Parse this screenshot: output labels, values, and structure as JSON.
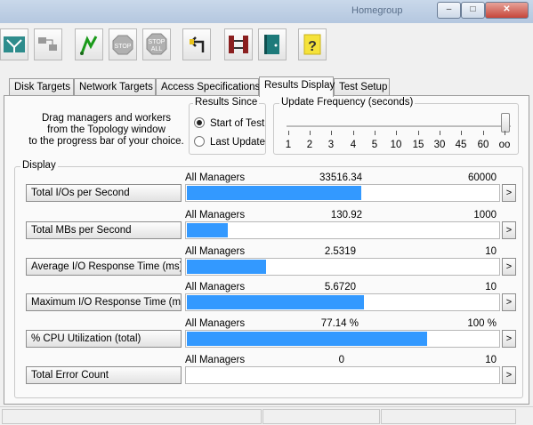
{
  "window": {
    "title_blurred": "Homegroup",
    "controls": [
      "–",
      "□",
      "✕"
    ]
  },
  "toolbar": {
    "buttons": [
      {
        "name": "topology-icon"
      },
      {
        "name": "disconnect-icon"
      },
      {
        "name": "start-flag-icon"
      },
      {
        "name": "stop-icon",
        "label": "STOP"
      },
      {
        "name": "stop-all-icon",
        "label": "STOP ALL"
      },
      {
        "name": "reset-icon"
      },
      {
        "name": "new-worker-icon"
      },
      {
        "name": "exit-icon"
      },
      {
        "name": "help-icon",
        "label": "?"
      }
    ]
  },
  "tabs": [
    "Disk Targets",
    "Network Targets",
    "Access Specifications",
    "Results Display",
    "Test Setup"
  ],
  "active_tab": "Results Display",
  "instructions": [
    "Drag managers and workers",
    "from the Topology window",
    "to the progress bar of your choice."
  ],
  "results_since": {
    "legend": "Results Since",
    "options": [
      "Start of Test",
      "Last Update"
    ],
    "selected": "Start of Test"
  },
  "update_frequency": {
    "legend": "Update Frequency (seconds)",
    "ticks": [
      "1",
      "2",
      "3",
      "4",
      "5",
      "10",
      "15",
      "30",
      "45",
      "60",
      "oo"
    ],
    "selected": "oo"
  },
  "display": {
    "legend": "Display",
    "go_label": ">",
    "bar_color": "#3399ff",
    "rows": [
      {
        "label": "Total I/Os per Second",
        "manager": "All Managers",
        "value": "33516.34",
        "max": "60000",
        "fraction": 0.5586
      },
      {
        "label": "Total MBs per Second",
        "manager": "All Managers",
        "value": "130.92",
        "max": "1000",
        "fraction": 0.1309
      },
      {
        "label": "Average I/O Response Time (ms)",
        "manager": "All Managers",
        "value": "2.5319",
        "max": "10",
        "fraction": 0.2532
      },
      {
        "label": "Maximum I/O Response Time (ms)",
        "manager": "All Managers",
        "value": "5.6720",
        "max": "10",
        "fraction": 0.5672
      },
      {
        "label": "% CPU Utilization (total)",
        "manager": "All Managers",
        "value": "77.14 %",
        "max": "100 %",
        "fraction": 0.7714
      },
      {
        "label": "Total Error Count",
        "manager": "All Managers",
        "value": "0",
        "max": "10",
        "fraction": 0
      }
    ]
  }
}
